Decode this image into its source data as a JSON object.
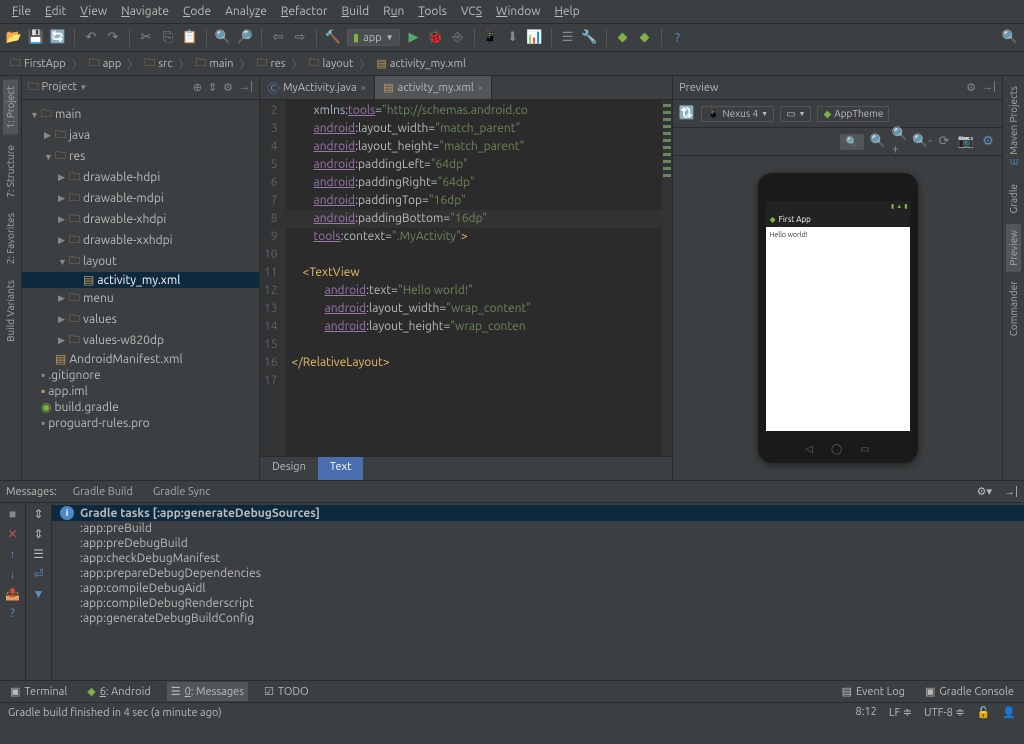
{
  "menu": {
    "file": "File",
    "edit": "Edit",
    "view": "View",
    "navigate": "Navigate",
    "code": "Code",
    "analyze": "Analyze",
    "refactor": "Refactor",
    "build": "Build",
    "run": "Run",
    "tools": "Tools",
    "vcs": "VCS",
    "window": "Window",
    "help": "Help"
  },
  "run_config": "app",
  "breadcrumb": [
    "FirstApp",
    "app",
    "src",
    "main",
    "res",
    "layout",
    "activity_my.xml"
  ],
  "project_label": "Project",
  "tree": {
    "main": "main",
    "java": "java",
    "res": "res",
    "drawable_hdpi": "drawable-hdpi",
    "drawable_mdpi": "drawable-mdpi",
    "drawable_xhdpi": "drawable-xhdpi",
    "drawable_xxhdpi": "drawable-xxhdpi",
    "layout": "layout",
    "activity_my": "activity_my.xml",
    "menu": "menu",
    "values": "values",
    "values_w820dp": "values-w820dp",
    "manifest": "AndroidManifest.xml",
    "gitignore": ".gitignore",
    "app_iml": "app.iml",
    "build_gradle": "build.gradle",
    "proguard": "proguard-rules.pro"
  },
  "tabs": {
    "java": "MyActivity.java",
    "xml": "activity_my.xml"
  },
  "gutter_start": 2,
  "code": {
    "l2": "        xmlns:tools=\"http://schemas.android.co",
    "l3_attr": "android",
    "l3_rest": ":layout_width=\"match_parent\"",
    "l4_attr": "android",
    "l4_rest": ":layout_height=\"match_parent\"",
    "l5_attr": "android",
    "l5_rest": ":paddingLeft=\"64dp\"",
    "l6_attr": "android",
    "l6_rest": ":paddingRight=\"64dp\"",
    "l7_attr": "android",
    "l7_rest": ":paddingTop=\"16dp\"",
    "l8_attr": "android",
    "l8_rest": ":paddingBottom=\"16dp\"",
    "l9_attr": "tools",
    "l9_rest": ":context=\".MyActivity\">",
    "l11": "    <TextView",
    "l12_attr": "android",
    "l12_rest": ":text=\"Hello world!\"",
    "l13_attr": "android",
    "l13_rest": ":layout_width=\"wrap_content\"",
    "l14_attr": "android",
    "l14_rest": ":layout_height=\"wrap_conten",
    "l16": "</RelativeLayout>"
  },
  "design_tabs": {
    "design": "Design",
    "text": "Text"
  },
  "preview": {
    "title": "Preview",
    "device": "Nexus 4",
    "theme": "AppTheme",
    "app_title": "First App",
    "content": "Hello world!"
  },
  "messages": {
    "tab_label": "Messages:",
    "gradle_build": "Gradle Build",
    "gradle_sync": "Gradle Sync",
    "head": "Gradle tasks [:app:generateDebugSources]",
    "lines": [
      ":app:preBuild",
      ":app:preDebugBuild",
      ":app:checkDebugManifest",
      ":app:prepareDebugDependencies",
      ":app:compileDebugAidl",
      ":app:compileDebugRenderscript",
      ":app:generateDebugBuildConfig"
    ]
  },
  "bottom": {
    "terminal": "Terminal",
    "android": "6: Android",
    "messages": "0: Messages",
    "todo": "TODO",
    "event_log": "Event Log",
    "gradle_console": "Gradle Console"
  },
  "status": {
    "msg": "Gradle build finished in 4 sec (a minute ago)",
    "pos": "8:12",
    "sep": "LF",
    "enc": "UTF-8"
  },
  "sidetabs": {
    "project": "1: Project",
    "structure": "7: Structure",
    "favorites": "2: Favorites",
    "build_variants": "Build Variants",
    "maven": "Maven Projects",
    "gradle": "Gradle",
    "preview": "Preview",
    "commander": "Commander"
  }
}
